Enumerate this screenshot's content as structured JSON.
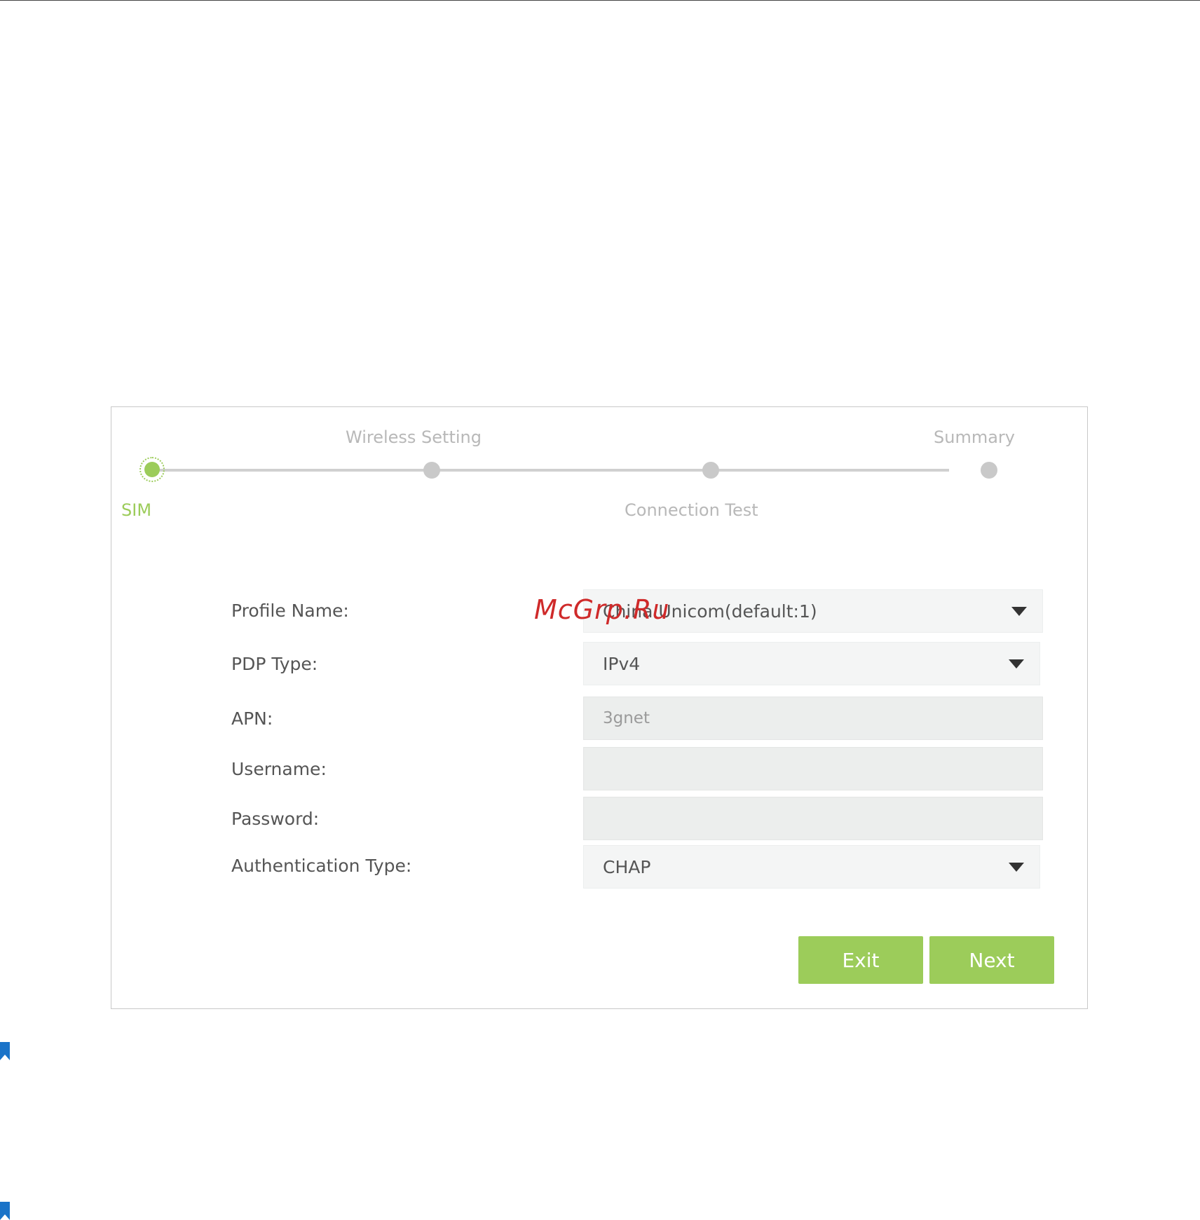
{
  "stepper": {
    "steps": [
      {
        "label": "SIM",
        "active": true
      },
      {
        "label": "Wireless Setting",
        "active": false
      },
      {
        "label": "Connection Test",
        "active": false
      },
      {
        "label": "Summary",
        "active": false
      }
    ]
  },
  "form": {
    "profile_name": {
      "label": "Profile Name:",
      "value": "China Unicom(default:1)"
    },
    "pdp_type": {
      "label": "PDP Type:",
      "value": "IPv4"
    },
    "apn": {
      "label": "APN:",
      "value": "3gnet"
    },
    "username": {
      "label": "Username:",
      "value": ""
    },
    "password": {
      "label": "Password:",
      "value": ""
    },
    "auth_type": {
      "label": "Authentication Type:",
      "value": "CHAP"
    }
  },
  "buttons": {
    "exit": "Exit",
    "next": "Next"
  },
  "watermark": "McGrp.Ru",
  "colors": {
    "accent": "#9ccc5a",
    "inactive": "#c9c9c9"
  }
}
